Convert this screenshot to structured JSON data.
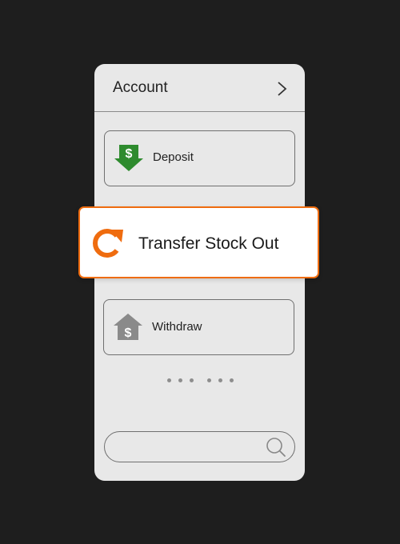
{
  "header": {
    "title": "Account",
    "chevron_icon": "chevron-right-icon"
  },
  "menu": {
    "deposit": {
      "label": "Deposit",
      "icon": "deposit-dollar-arrow-icon",
      "icon_color": "#2e8b2e"
    },
    "transfer": {
      "label": "Transfer Stock Out",
      "icon": "refresh-arrow-icon",
      "icon_color": "#ef6c0f",
      "highlighted": true
    },
    "withdraw": {
      "label": "Withdraw",
      "icon": "withdraw-dollar-house-icon",
      "icon_color": "#8a8a8a"
    }
  },
  "pagination": {
    "icon": "more-dots-icon"
  },
  "search": {
    "placeholder": "",
    "icon": "search-icon"
  },
  "colors": {
    "background": "#1e1e1e",
    "panel": "#e8e8e8",
    "accent": "#ef6c0f",
    "deposit_green": "#2e8b2e"
  }
}
